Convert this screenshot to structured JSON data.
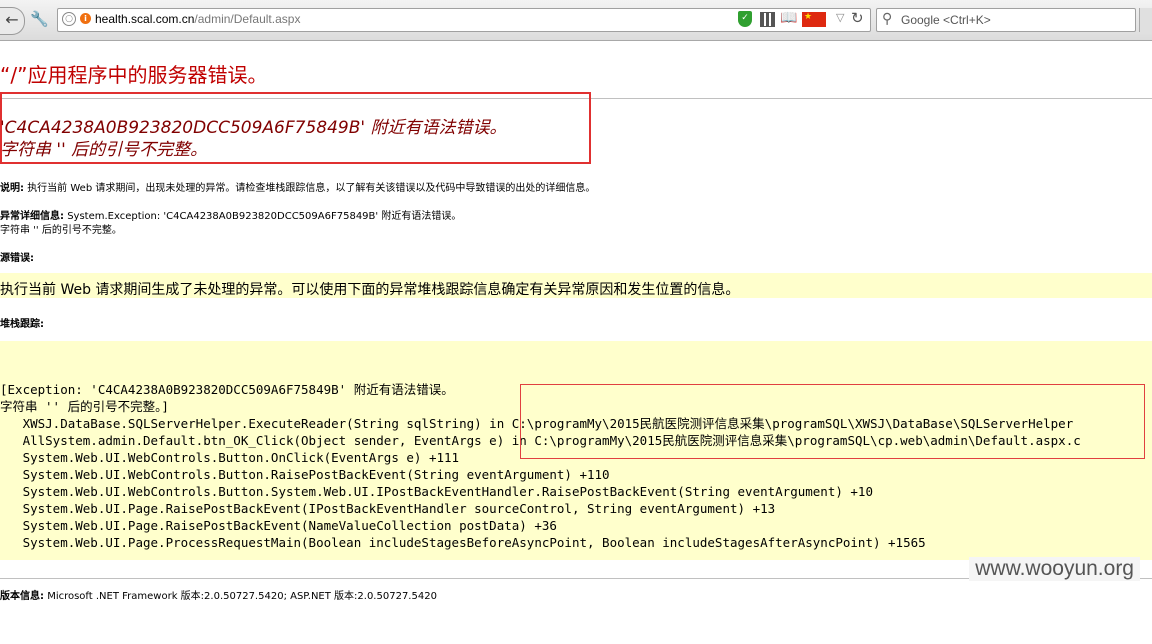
{
  "browser": {
    "url_host": "health.scal.com.cn",
    "url_path": "/admin/Default.aspx",
    "search_placeholder": "Google <Ctrl+K>"
  },
  "page": {
    "title": "“/”应用程序中的服务器错误。",
    "message_line1": "'C4CA4238A0B923820DCC509A6F75849B' 附近有语法错误。",
    "message_line2": "字符串 '' 后的引号不完整。",
    "description_label": "说明:",
    "description_text": "执行当前 Web 请求期间，出现未处理的异常。请检查堆栈跟踪信息，以了解有关该错误以及代码中导致错误的出处的详细信息。",
    "exception_label": "异常详细信息:",
    "exception_text": "System.Exception: 'C4CA4238A0B923820DCC509A6F75849B' 附近有语法错误。",
    "exception_text2": "字符串 '' 后的引号不完整。",
    "source_error_label": "源错误:",
    "source_error_text": "执行当前 Web 请求期间生成了未处理的异常。可以使用下面的异常堆栈跟踪信息确定有关异常原因和发生位置的信息。",
    "stack_trace_label": "堆栈跟踪:",
    "stack_trace": [
      "[Exception: 'C4CA4238A0B923820DCC509A6F75849B' 附近有语法错误。",
      "字符串 '' 后的引号不完整。]",
      "   XWSJ.DataBase.SQLServerHelper.ExecuteReader(String sqlString) in C:\\programMy\\2015民航医院测评信息采集\\programSQL\\XWSJ\\DataBase\\SQLServerHelper",
      "   AllSystem.admin.Default.btn_OK_Click(Object sender, EventArgs e) in C:\\programMy\\2015民航医院测评信息采集\\programSQL\\cp.web\\admin\\Default.aspx.c",
      "   System.Web.UI.WebControls.Button.OnClick(EventArgs e) +111",
      "   System.Web.UI.WebControls.Button.RaisePostBackEvent(String eventArgument) +110",
      "   System.Web.UI.WebControls.Button.System.Web.UI.IPostBackEventHandler.RaisePostBackEvent(String eventArgument) +10",
      "   System.Web.UI.Page.RaisePostBackEvent(IPostBackEventHandler sourceControl, String eventArgument) +13",
      "   System.Web.UI.Page.RaisePostBackEvent(NameValueCollection postData) +36",
      "   System.Web.UI.Page.ProcessRequestMain(Boolean includeStagesBeforeAsyncPoint, Boolean includeStagesAfterAsyncPoint) +1565"
    ],
    "version_label": "版本信息:",
    "version_text": "Microsoft .NET Framework 版本:2.0.50727.5420; ASP.NET 版本:2.0.50727.5420"
  },
  "watermark": "www.wooyun.org",
  "icons": {
    "back": "back-arrow-icon",
    "tools": "wrench-icon",
    "globe": "globe-icon",
    "security": "shield-icon",
    "reload": "reload-icon",
    "search": "search-icon"
  },
  "colors": {
    "title": "#c00000",
    "message": "#800000",
    "highlight_bg": "#ffffcc",
    "annotation_border": "#e03030"
  }
}
